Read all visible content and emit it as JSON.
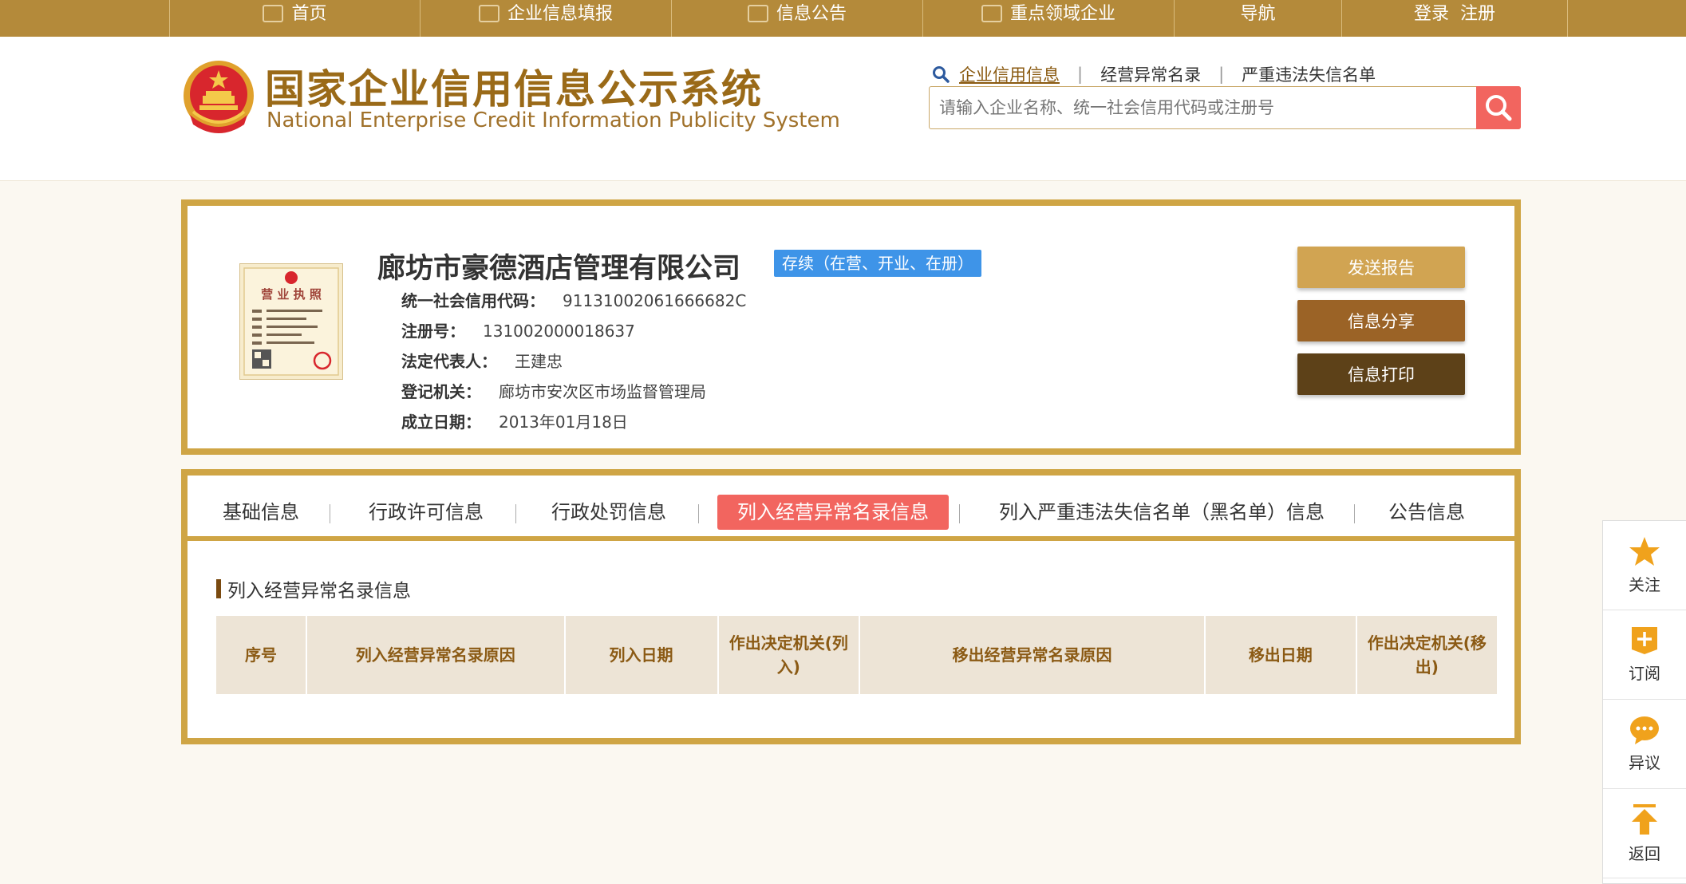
{
  "topnav": {
    "items": [
      {
        "label": "首页",
        "icon": "monitor-icon"
      },
      {
        "label": "企业信息填报",
        "icon": "edit-icon"
      },
      {
        "label": "信息公告",
        "icon": "document-icon"
      },
      {
        "label": "重点领域企业",
        "icon": "megaphone-icon"
      },
      {
        "label": "导航",
        "icon": ""
      },
      {
        "label": "登录  注册",
        "icon": ""
      }
    ]
  },
  "header": {
    "logo_cn": "国家企业信用信息公示系统",
    "logo_en": "National Enterprise Credit Information Publicity System",
    "quick_links": [
      "企业信用信息",
      "经营异常名录",
      "严重违法失信名单"
    ],
    "search_placeholder": "请输入企业名称、统一社会信用代码或注册号"
  },
  "company": {
    "name": "廊坊市豪德酒店管理有限公司",
    "status": "存续（在营、开业、在册）",
    "fields": [
      {
        "key": "统一社会信用代码：",
        "value": "91131002061666682C"
      },
      {
        "key": "注册号：",
        "value": "131002000018637"
      },
      {
        "key": "法定代表人：",
        "value": "王建忠"
      },
      {
        "key": "登记机关：",
        "value": "廊坊市安次区市场监督管理局"
      },
      {
        "key": "成立日期：",
        "value": "2013年01月18日"
      }
    ],
    "license_title": "营 业 执 照",
    "actions": [
      {
        "label": "发送报告",
        "color": "#d1a452"
      },
      {
        "label": "信息分享",
        "color": "#9b6326"
      },
      {
        "label": "信息打印",
        "color": "#5d4118"
      }
    ]
  },
  "tabs": {
    "items": [
      "基础信息",
      "行政许可信息",
      "行政处罚信息",
      "列入经营异常名录信息",
      "列入严重违法失信名单（黑名单）信息",
      "公告信息"
    ],
    "active_index": 3
  },
  "section": {
    "title": "列入经营异常名录信息",
    "columns": [
      "序号",
      "列入经营异常名录原因",
      "列入日期",
      "作出决定机关(列入)",
      "移出经营异常名录原因",
      "移出日期",
      "作出决定机关(移出)"
    ]
  },
  "float_bar": [
    {
      "label": "关注",
      "icon": "star-icon"
    },
    {
      "label": "订阅",
      "icon": "subscribe-plus-icon"
    },
    {
      "label": "异议",
      "icon": "chat-bubble-icon"
    },
    {
      "label": "返回",
      "icon": "arrow-up-icon"
    }
  ],
  "colors": {
    "gold": "#b48a3a",
    "border_gold": "#cfa545",
    "accent_red": "#f2655f",
    "status_blue": "#3e94e8"
  }
}
